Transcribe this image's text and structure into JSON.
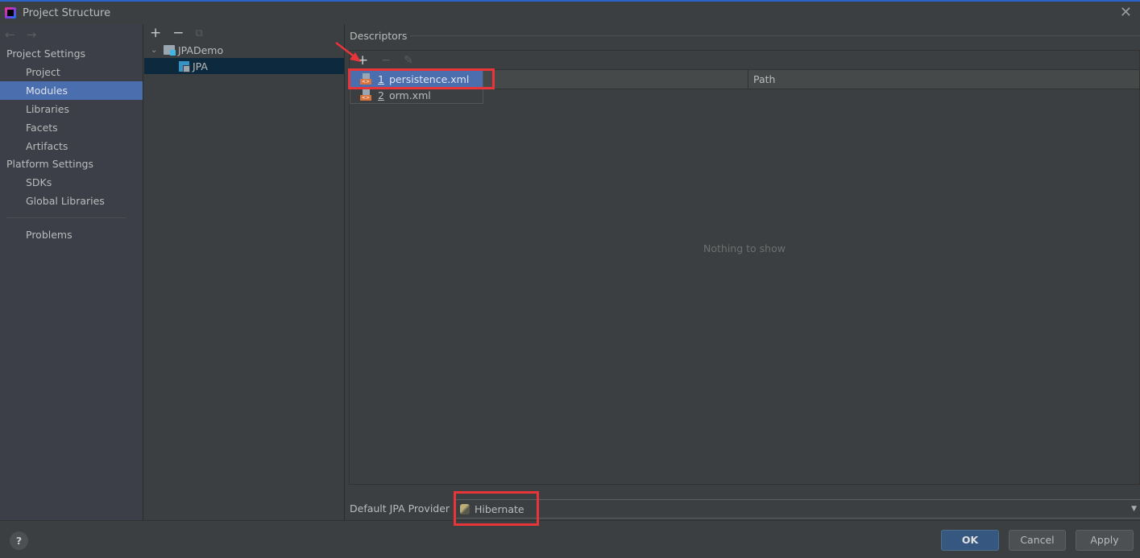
{
  "window": {
    "title": "Project Structure",
    "close_icon": "close-icon"
  },
  "sidebar": {
    "sections": [
      {
        "header": "Project Settings",
        "items": [
          {
            "label": "Project",
            "selected": false
          },
          {
            "label": "Modules",
            "selected": true
          },
          {
            "label": "Libraries",
            "selected": false
          },
          {
            "label": "Facets",
            "selected": false
          },
          {
            "label": "Artifacts",
            "selected": false
          }
        ]
      },
      {
        "header": "Platform Settings",
        "items": [
          {
            "label": "SDKs",
            "selected": false
          },
          {
            "label": "Global Libraries",
            "selected": false
          }
        ]
      }
    ],
    "problems": "Problems",
    "back_icon": "←",
    "forward_icon": "→"
  },
  "module_tree": {
    "toolbar": {
      "add": "+",
      "remove": "−",
      "copy": "⧉"
    },
    "root": "JPADemo",
    "child": "JPA"
  },
  "descriptors": {
    "title": "Descriptors",
    "toolbar": {
      "add": "+",
      "remove": "−",
      "edit": "✎"
    },
    "columns": [
      "",
      "Path"
    ],
    "empty_text": "Nothing to show",
    "popup_items": [
      {
        "num": "1",
        "label": "persistence.xml",
        "selected": true
      },
      {
        "num": "2",
        "label": "orm.xml",
        "selected": false
      }
    ]
  },
  "provider": {
    "label": "Default JPA Provider",
    "value": "Hibernate"
  },
  "footer": {
    "help": "?",
    "ok": "OK",
    "cancel": "Cancel",
    "apply": "Apply"
  },
  "colors": {
    "accent": "#4b6eaf",
    "annotation": "#e8353a",
    "ok_button": "#365880"
  }
}
